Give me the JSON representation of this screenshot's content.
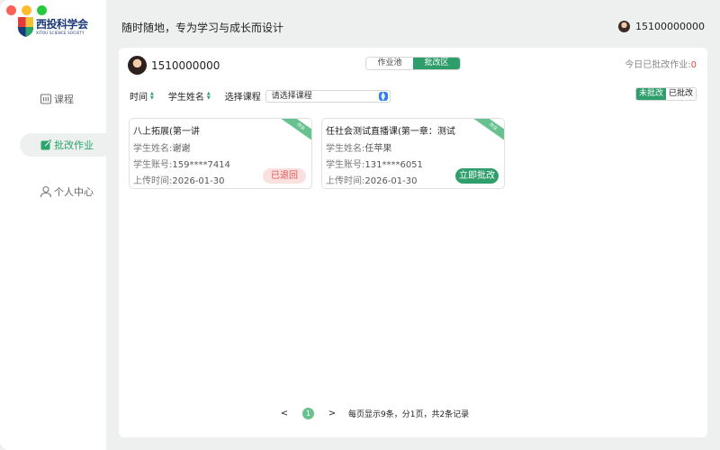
{
  "logo": {
    "cn": "西投科学会",
    "en": "XITOU SCIENCE SOCIETY"
  },
  "sidebar": {
    "items": [
      {
        "label": "课程",
        "icon": "course-icon"
      },
      {
        "label": "批改作业",
        "icon": "edit-icon"
      },
      {
        "label": "个人中心",
        "icon": "person-icon"
      }
    ]
  },
  "header": {
    "slogan": "随时随地，专为学习与成长而设计",
    "user": "15100000000"
  },
  "panel": {
    "user": "1510000000",
    "tabs": [
      "作业池",
      "批改区"
    ],
    "today_label": "今日已批改作业:",
    "today_count": "0"
  },
  "filters": {
    "time": "时间",
    "student": "学生姓名",
    "course_label": "选择课程",
    "course_placeholder": "请选择课程",
    "status": [
      "未批改",
      "已批改"
    ]
  },
  "cards": [
    {
      "tag": "作业",
      "title": "八上拓展(第一讲",
      "name_label": "学生姓名:",
      "name": "谢谢",
      "account_label": "学生账号:",
      "account": "159****7414",
      "time_label": "上传时间:",
      "time": "2026-01-30",
      "action": "已退回"
    },
    {
      "tag": "作业",
      "title": "任社会测试直播课(第一章：测试",
      "name_label": "学生姓名:",
      "name": "任苹果",
      "account_label": "学生账号:",
      "account": "131****6051",
      "time_label": "上传时间:",
      "time": "2026-01-30",
      "action": "立即批改"
    }
  ],
  "pagination": {
    "prev": "<",
    "current": "1",
    "next": ">",
    "summary": "每页显示9条，分1页，共2条记录"
  },
  "colors": {
    "accent": "#2e9e6b",
    "danger": "#e05555"
  }
}
